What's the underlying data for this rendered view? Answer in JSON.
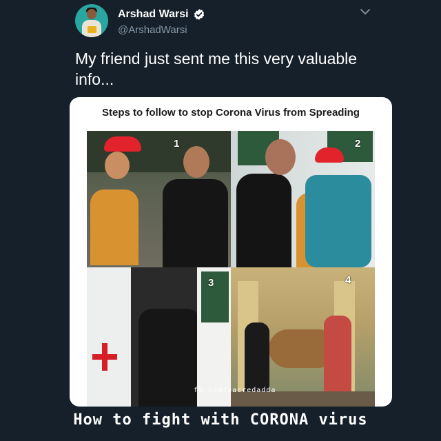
{
  "tweet": {
    "author_name": "Arshad Warsi",
    "author_handle": "@ArshadWarsi",
    "text": "My friend just sent me this very valuable info...",
    "verified": true
  },
  "image": {
    "title": "Steps to follow to stop Corona Virus from Spreading",
    "panels": [
      {
        "number": "1"
      },
      {
        "number": "2"
      },
      {
        "number": "3"
      },
      {
        "number": "4"
      }
    ],
    "watermark": "fb.com/sacredadda"
  },
  "caption": "How to fight with CORONA virus",
  "colors": {
    "background": "#15202b",
    "verified_badge": "#ffffff",
    "handle": "#8899a6"
  },
  "icons": {
    "verified": "verified-badge-icon",
    "menu": "chevron-down-icon"
  }
}
